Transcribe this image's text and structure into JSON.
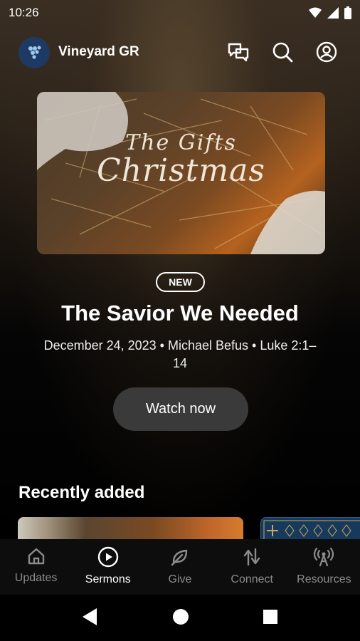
{
  "status_bar": {
    "time": "10:26"
  },
  "app_bar": {
    "brand": "Vineyard GR"
  },
  "hero": {
    "image_title_line1": "The Gifts",
    "image_title_line2": "Christmas",
    "badge": "NEW",
    "title": "The Savior We Needed",
    "meta": "December 24, 2023 • Michael Befus • Luke 2:1–14",
    "watch_label": "Watch now"
  },
  "recent": {
    "heading": "Recently added"
  },
  "bottom_nav": {
    "items": [
      {
        "label": "Updates",
        "icon": "home-icon"
      },
      {
        "label": "Sermons",
        "icon": "play-circle-icon"
      },
      {
        "label": "Give",
        "icon": "give-leaf-icon"
      },
      {
        "label": "Connect",
        "icon": "connect-arrows-icon"
      },
      {
        "label": "Resources",
        "icon": "broadcast-icon"
      }
    ],
    "active_index": 1
  }
}
